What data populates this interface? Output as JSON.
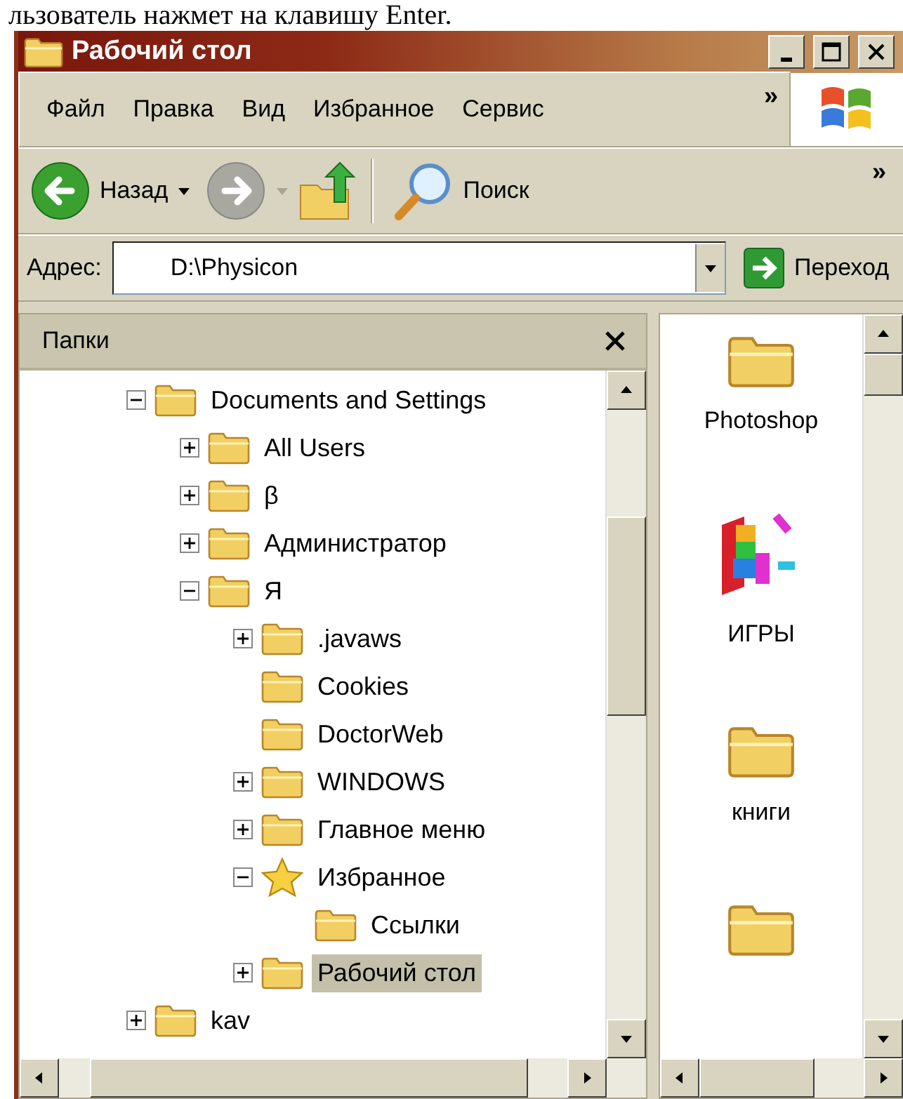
{
  "document_text": "льзователь нажмет на клавишу Enter.",
  "window": {
    "title": "Рабочий стол"
  },
  "menu": [
    "Файл",
    "Правка",
    "Вид",
    "Избранное",
    "Сервис"
  ],
  "menu_overflow": "»",
  "toolbar": {
    "back": "Назад",
    "search": "Поиск",
    "overflow": "»"
  },
  "address": {
    "label": "Адрес:",
    "value": "D:\\Physicon",
    "go": "Переход"
  },
  "folders_pane": {
    "title": "Папки"
  },
  "tree": [
    {
      "label": "Documents and Settings",
      "kind": "folder",
      "expandable": true,
      "expanded": true,
      "selected": false,
      "children": [
        {
          "label": "All Users",
          "kind": "folder",
          "expandable": true,
          "expanded": false,
          "selected": false
        },
        {
          "label": "β",
          "kind": "folder",
          "expandable": true,
          "expanded": false,
          "selected": false
        },
        {
          "label": "Администратор",
          "kind": "folder",
          "expandable": true,
          "expanded": false,
          "selected": false
        },
        {
          "label": "Я",
          "kind": "folder",
          "expandable": true,
          "expanded": true,
          "selected": false,
          "children": [
            {
              "label": ".javaws",
              "kind": "folder",
              "expandable": true,
              "expanded": false,
              "selected": false
            },
            {
              "label": "Cookies",
              "kind": "folder",
              "selected": false
            },
            {
              "label": "DoctorWeb",
              "kind": "folder",
              "selected": false
            },
            {
              "label": "WINDOWS",
              "kind": "folder",
              "expandable": true,
              "expanded": false,
              "selected": false
            },
            {
              "label": "Главное меню",
              "kind": "folder",
              "expandable": true,
              "expanded": false,
              "selected": false
            },
            {
              "label": "Избранное",
              "kind": "favorites",
              "expandable": true,
              "expanded": true,
              "selected": false,
              "children": [
                {
                  "label": "Ссылки",
                  "kind": "folder",
                  "selected": false
                }
              ]
            },
            {
              "label": "Рабочий стол",
              "kind": "folder",
              "expandable": true,
              "expanded": false,
              "selected": true
            }
          ]
        }
      ]
    },
    {
      "label": "kav",
      "kind": "folder",
      "expandable": true,
      "expanded": false,
      "selected": false
    }
  ],
  "files": [
    {
      "name": "Photoshop",
      "kind": "folder"
    },
    {
      "name": "ИГРЫ",
      "kind": "app"
    },
    {
      "name": "книги",
      "kind": "folder"
    },
    {
      "kind": "folder"
    }
  ]
}
